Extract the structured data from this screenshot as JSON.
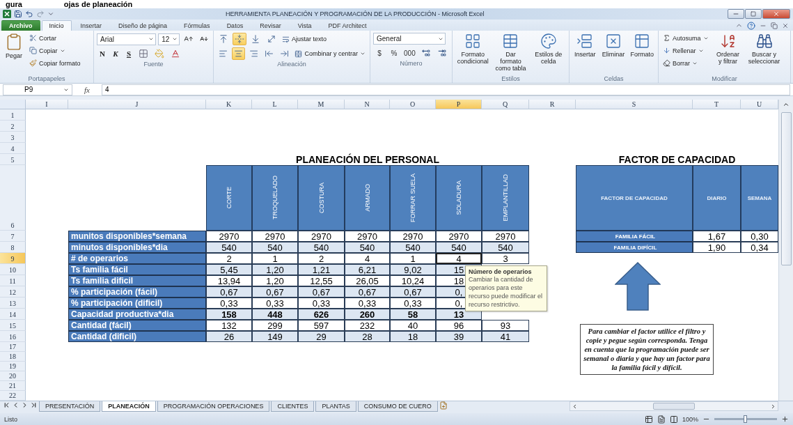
{
  "caption": [
    "gura",
    "ojas de planeación"
  ],
  "window": {
    "title": "HERRAMIENTA PLANEACIÓN Y PROGRAMACIÓN DE LA PRODUCCIÓN - Microsoft Excel"
  },
  "ribbon_tabs": [
    {
      "label": "Archivo",
      "kind": "file",
      "selected": false
    },
    {
      "label": "Inicio",
      "kind": "tab",
      "selected": true
    },
    {
      "label": "Insertar",
      "kind": "tab",
      "selected": false
    },
    {
      "label": "Diseño de página",
      "kind": "tab",
      "selected": false
    },
    {
      "label": "Fórmulas",
      "kind": "tab",
      "selected": false
    },
    {
      "label": "Datos",
      "kind": "tab",
      "selected": false
    },
    {
      "label": "Revisar",
      "kind": "tab",
      "selected": false
    },
    {
      "label": "Vista",
      "kind": "tab",
      "selected": false
    },
    {
      "label": "PDF Architect",
      "kind": "tab",
      "selected": false
    }
  ],
  "clipboard": {
    "label": "Portapapeles",
    "paste": "Pegar",
    "cut": "Cortar",
    "copy": "Copiar",
    "format_painter": "Copiar formato"
  },
  "font": {
    "label": "Fuente",
    "name": "Arial",
    "size": "12",
    "bold": "N",
    "italic": "K",
    "underline": "S"
  },
  "alignment": {
    "label": "Alineación",
    "vertical_buttons": [
      {
        "kind": "top",
        "selected": false
      },
      {
        "kind": "middle",
        "selected": true
      },
      {
        "kind": "bottom",
        "selected": false
      }
    ],
    "horizontal_buttons": [
      {
        "kind": "left",
        "selected": false
      },
      {
        "kind": "center",
        "selected": true
      },
      {
        "kind": "right",
        "selected": false
      }
    ],
    "wrap": "Ajustar texto",
    "merge": "Combinar y centrar"
  },
  "number": {
    "label": "Número",
    "format": "General",
    "currency": "$",
    "percent": "%",
    "thousands": "000"
  },
  "styles": {
    "label": "Estilos",
    "items": [
      "Formato condicional",
      "Dar formato como tabla",
      "Estilos de celda"
    ]
  },
  "cells": {
    "label": "Celdas",
    "items": [
      "Insertar",
      "Eliminar",
      "Formato"
    ]
  },
  "editing": {
    "label": "Modificar",
    "autosum": "Autosuma",
    "fill": "Rellenar",
    "clear": "Borrar",
    "sort": "Ordenar y filtrar",
    "find": "Buscar y seleccionar"
  },
  "formula_bar": {
    "name_box": "P9",
    "function_label": "fx",
    "value": "4"
  },
  "columns": [
    {
      "label": "I",
      "selected": false
    },
    {
      "label": "J",
      "selected": false
    },
    {
      "label": "K",
      "selected": false
    },
    {
      "label": "L",
      "selected": false
    },
    {
      "label": "M",
      "selected": false
    },
    {
      "label": "N",
      "selected": false
    },
    {
      "label": "O",
      "selected": false
    },
    {
      "label": "P",
      "selected": true
    },
    {
      "label": "Q",
      "selected": false
    },
    {
      "label": "R",
      "selected": false
    },
    {
      "label": "S",
      "selected": false
    },
    {
      "label": "T",
      "selected": false
    },
    {
      "label": "U",
      "selected": false
    }
  ],
  "rows": [
    {
      "label": "1",
      "selected": false
    },
    {
      "label": "2",
      "selected": false
    },
    {
      "label": "3",
      "selected": false
    },
    {
      "label": "4",
      "selected": false
    },
    {
      "label": "5",
      "selected": false
    },
    {
      "label": "6",
      "selected": false
    },
    {
      "label": "7",
      "selected": false
    },
    {
      "label": "8",
      "selected": false
    },
    {
      "label": "9",
      "selected": true
    },
    {
      "label": "10",
      "selected": false
    },
    {
      "label": "11",
      "selected": false
    },
    {
      "label": "12",
      "selected": false
    },
    {
      "label": "13",
      "selected": false
    },
    {
      "label": "14",
      "selected": false
    },
    {
      "label": "15",
      "selected": false
    },
    {
      "label": "16",
      "selected": false
    },
    {
      "label": "17",
      "selected": false
    },
    {
      "label": "18",
      "selected": false
    },
    {
      "label": "19",
      "selected": false
    },
    {
      "label": "20",
      "selected": false
    },
    {
      "label": "21",
      "selected": false
    },
    {
      "label": "22",
      "selected": false
    }
  ],
  "planning": {
    "title": "PLANEACIÓN DEL PERSONAL",
    "headers": [
      "CORTE",
      "TROQUELADO",
      "COSTURA",
      "ARMADO",
      "FORRAR SUELA",
      "SOLADURA",
      "EMPLANTILLAD"
    ],
    "rows": [
      {
        "label": "munitos disponibles*semana",
        "bold": false,
        "values": [
          "2970",
          "2970",
          "2970",
          "2970",
          "2970",
          "2970",
          "2970"
        ]
      },
      {
        "label": "minutos disponibles*dia",
        "bold": false,
        "values": [
          "540",
          "540",
          "540",
          "540",
          "540",
          "540",
          "540"
        ]
      },
      {
        "label": "# de operarios",
        "bold": false,
        "values": [
          "2",
          "1",
          "2",
          "4",
          "1",
          "4",
          "3"
        ]
      },
      {
        "label": "Ts familia fácil",
        "bold": false,
        "values": [
          "5,45",
          "1,20",
          "1,21",
          "6,21",
          "9,02",
          "15"
        ]
      },
      {
        "label": "Ts familia dificil",
        "bold": false,
        "values": [
          "13,94",
          "1,20",
          "12,55",
          "26,05",
          "10,24",
          "18"
        ]
      },
      {
        "label": "% participación (fácil)",
        "bold": false,
        "values": [
          "0,67",
          "0,67",
          "0,67",
          "0,67",
          "0,67",
          "0,"
        ]
      },
      {
        "label": "% participación (dificil)",
        "bold": false,
        "values": [
          "0,33",
          "0,33",
          "0,33",
          "0,33",
          "0,33",
          "0,"
        ]
      },
      {
        "label": "Capacidad productiva*dia",
        "bold": true,
        "values": [
          "158",
          "448",
          "626",
          "260",
          "58",
          "13"
        ]
      },
      {
        "label": "Cantidad (fácil)",
        "bold": false,
        "values": [
          "132",
          "299",
          "597",
          "232",
          "40",
          "96",
          "93"
        ]
      },
      {
        "label": "Cantidad (dificil)",
        "bold": false,
        "values": [
          "26",
          "149",
          "29",
          "28",
          "18",
          "39",
          "41"
        ]
      }
    ]
  },
  "tooltip": {
    "title": "Número de operarios",
    "text": "Cambiar la cantidad de operarios para este recurso puede modificar el recurso restrictivo."
  },
  "factor": {
    "title": "FACTOR DE CAPACIDAD",
    "headers": [
      "FACTOR DE CAPACIDAD",
      "DIARIO",
      "SEMANA"
    ],
    "rows": [
      {
        "label": "FAMILIA FÁCIL",
        "values": [
          "1,67",
          "0,30"
        ]
      },
      {
        "label": "FAMILIA DIFÍCIL",
        "values": [
          "1,90",
          "0,34"
        ]
      }
    ]
  },
  "note": {
    "text": "Para cambiar el factor utilice el filtro y copie y pegue según corresponda. Tenga en cuenta que la programación puede ser semanal o diaria y que hay un factor para la familia fácil y difícil."
  },
  "sheet_tabs": [
    {
      "label": "PRESENTACIÓN",
      "selected": false
    },
    {
      "label": "PLANEACIÓN",
      "selected": true
    },
    {
      "label": "PROGRAMACIÓN OPERACIONES",
      "selected": false
    },
    {
      "label": "CLIENTES",
      "selected": false
    },
    {
      "label": "PLANTAS",
      "selected": false
    },
    {
      "label": "CONSUMO DE CUERO",
      "selected": false
    }
  ],
  "status_bar": {
    "text": "Listo",
    "zoom": "100%",
    "zoom_slider": {
      "level": 0.5
    }
  }
}
